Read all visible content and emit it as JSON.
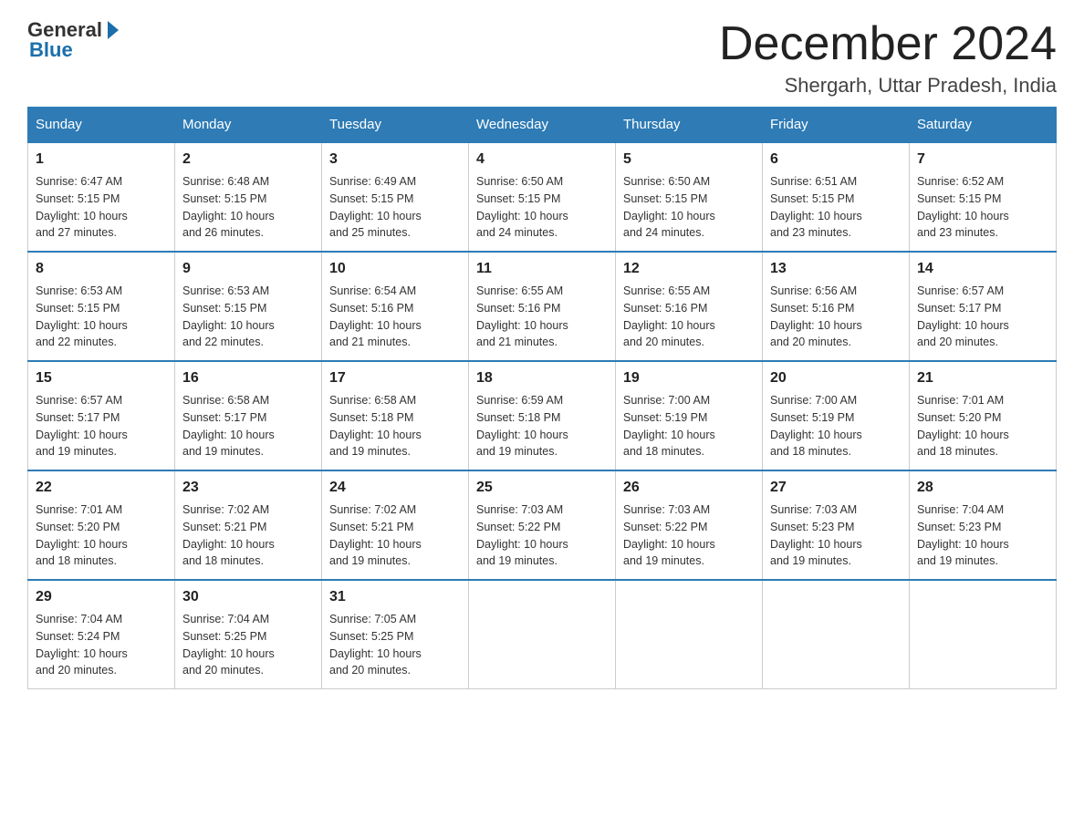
{
  "logo": {
    "general": "General",
    "blue": "Blue"
  },
  "title": "December 2024",
  "location": "Shergarh, Uttar Pradesh, India",
  "days_of_week": [
    "Sunday",
    "Monday",
    "Tuesday",
    "Wednesday",
    "Thursday",
    "Friday",
    "Saturday"
  ],
  "weeks": [
    [
      {
        "day": "1",
        "info": "Sunrise: 6:47 AM\nSunset: 5:15 PM\nDaylight: 10 hours\nand 27 minutes."
      },
      {
        "day": "2",
        "info": "Sunrise: 6:48 AM\nSunset: 5:15 PM\nDaylight: 10 hours\nand 26 minutes."
      },
      {
        "day": "3",
        "info": "Sunrise: 6:49 AM\nSunset: 5:15 PM\nDaylight: 10 hours\nand 25 minutes."
      },
      {
        "day": "4",
        "info": "Sunrise: 6:50 AM\nSunset: 5:15 PM\nDaylight: 10 hours\nand 24 minutes."
      },
      {
        "day": "5",
        "info": "Sunrise: 6:50 AM\nSunset: 5:15 PM\nDaylight: 10 hours\nand 24 minutes."
      },
      {
        "day": "6",
        "info": "Sunrise: 6:51 AM\nSunset: 5:15 PM\nDaylight: 10 hours\nand 23 minutes."
      },
      {
        "day": "7",
        "info": "Sunrise: 6:52 AM\nSunset: 5:15 PM\nDaylight: 10 hours\nand 23 minutes."
      }
    ],
    [
      {
        "day": "8",
        "info": "Sunrise: 6:53 AM\nSunset: 5:15 PM\nDaylight: 10 hours\nand 22 minutes."
      },
      {
        "day": "9",
        "info": "Sunrise: 6:53 AM\nSunset: 5:15 PM\nDaylight: 10 hours\nand 22 minutes."
      },
      {
        "day": "10",
        "info": "Sunrise: 6:54 AM\nSunset: 5:16 PM\nDaylight: 10 hours\nand 21 minutes."
      },
      {
        "day": "11",
        "info": "Sunrise: 6:55 AM\nSunset: 5:16 PM\nDaylight: 10 hours\nand 21 minutes."
      },
      {
        "day": "12",
        "info": "Sunrise: 6:55 AM\nSunset: 5:16 PM\nDaylight: 10 hours\nand 20 minutes."
      },
      {
        "day": "13",
        "info": "Sunrise: 6:56 AM\nSunset: 5:16 PM\nDaylight: 10 hours\nand 20 minutes."
      },
      {
        "day": "14",
        "info": "Sunrise: 6:57 AM\nSunset: 5:17 PM\nDaylight: 10 hours\nand 20 minutes."
      }
    ],
    [
      {
        "day": "15",
        "info": "Sunrise: 6:57 AM\nSunset: 5:17 PM\nDaylight: 10 hours\nand 19 minutes."
      },
      {
        "day": "16",
        "info": "Sunrise: 6:58 AM\nSunset: 5:17 PM\nDaylight: 10 hours\nand 19 minutes."
      },
      {
        "day": "17",
        "info": "Sunrise: 6:58 AM\nSunset: 5:18 PM\nDaylight: 10 hours\nand 19 minutes."
      },
      {
        "day": "18",
        "info": "Sunrise: 6:59 AM\nSunset: 5:18 PM\nDaylight: 10 hours\nand 19 minutes."
      },
      {
        "day": "19",
        "info": "Sunrise: 7:00 AM\nSunset: 5:19 PM\nDaylight: 10 hours\nand 18 minutes."
      },
      {
        "day": "20",
        "info": "Sunrise: 7:00 AM\nSunset: 5:19 PM\nDaylight: 10 hours\nand 18 minutes."
      },
      {
        "day": "21",
        "info": "Sunrise: 7:01 AM\nSunset: 5:20 PM\nDaylight: 10 hours\nand 18 minutes."
      }
    ],
    [
      {
        "day": "22",
        "info": "Sunrise: 7:01 AM\nSunset: 5:20 PM\nDaylight: 10 hours\nand 18 minutes."
      },
      {
        "day": "23",
        "info": "Sunrise: 7:02 AM\nSunset: 5:21 PM\nDaylight: 10 hours\nand 18 minutes."
      },
      {
        "day": "24",
        "info": "Sunrise: 7:02 AM\nSunset: 5:21 PM\nDaylight: 10 hours\nand 19 minutes."
      },
      {
        "day": "25",
        "info": "Sunrise: 7:03 AM\nSunset: 5:22 PM\nDaylight: 10 hours\nand 19 minutes."
      },
      {
        "day": "26",
        "info": "Sunrise: 7:03 AM\nSunset: 5:22 PM\nDaylight: 10 hours\nand 19 minutes."
      },
      {
        "day": "27",
        "info": "Sunrise: 7:03 AM\nSunset: 5:23 PM\nDaylight: 10 hours\nand 19 minutes."
      },
      {
        "day": "28",
        "info": "Sunrise: 7:04 AM\nSunset: 5:23 PM\nDaylight: 10 hours\nand 19 minutes."
      }
    ],
    [
      {
        "day": "29",
        "info": "Sunrise: 7:04 AM\nSunset: 5:24 PM\nDaylight: 10 hours\nand 20 minutes."
      },
      {
        "day": "30",
        "info": "Sunrise: 7:04 AM\nSunset: 5:25 PM\nDaylight: 10 hours\nand 20 minutes."
      },
      {
        "day": "31",
        "info": "Sunrise: 7:05 AM\nSunset: 5:25 PM\nDaylight: 10 hours\nand 20 minutes."
      },
      {
        "day": "",
        "info": ""
      },
      {
        "day": "",
        "info": ""
      },
      {
        "day": "",
        "info": ""
      },
      {
        "day": "",
        "info": ""
      }
    ]
  ]
}
